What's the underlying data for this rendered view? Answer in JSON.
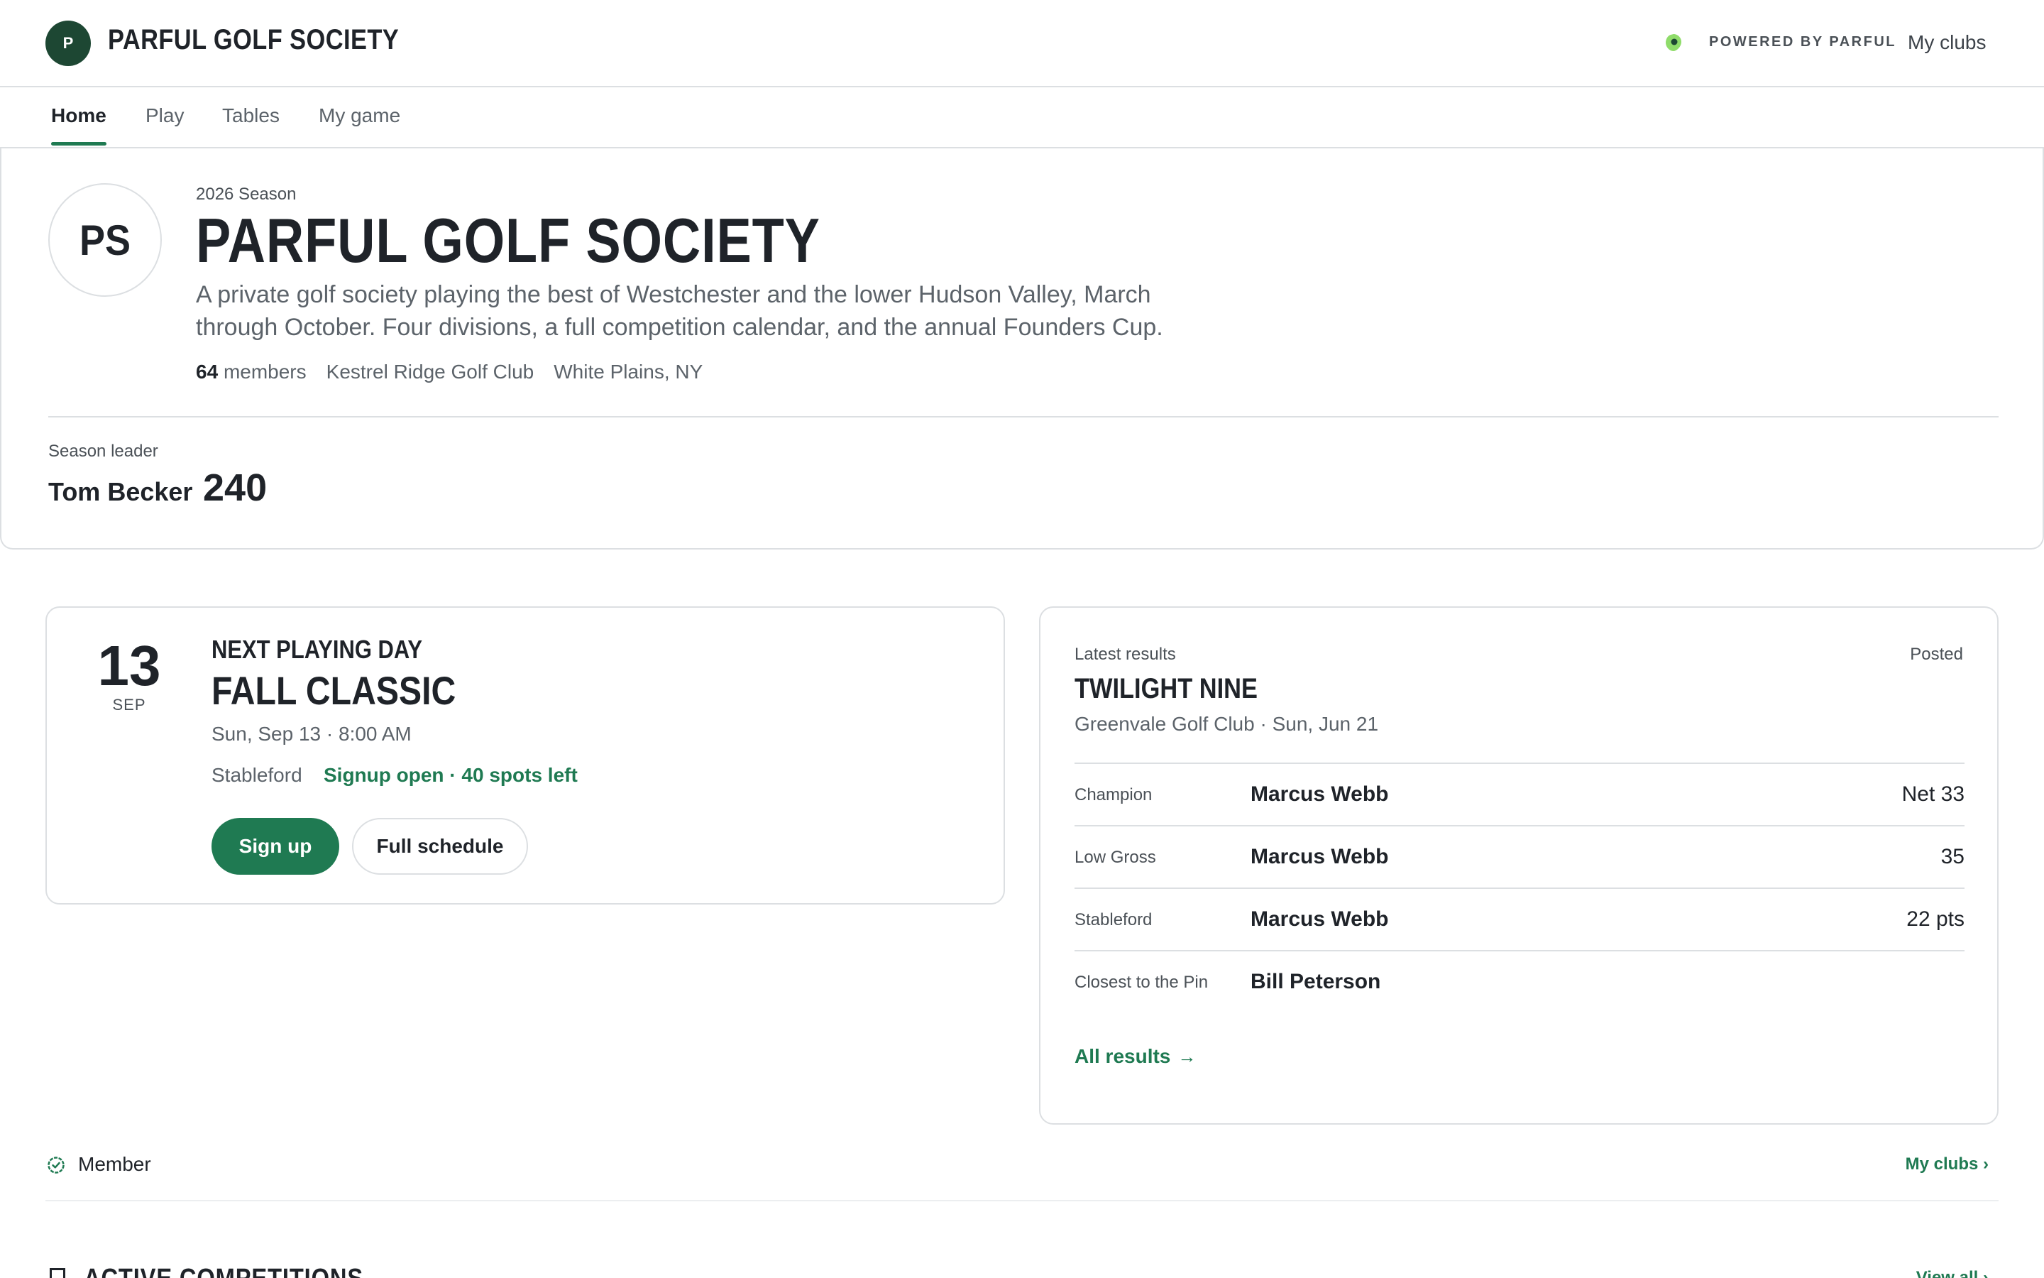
{
  "header": {
    "logo_letter": "P",
    "brand_name": "PARFUL GOLF SOCIETY",
    "powered_by": "POWERED BY PARFUL",
    "my_clubs": "My clubs"
  },
  "tabs": [
    {
      "label": "Home",
      "active": true
    },
    {
      "label": "Play",
      "active": false
    },
    {
      "label": "Tables",
      "active": false
    },
    {
      "label": "My game",
      "active": false
    }
  ],
  "hero": {
    "avatar_initials": "PS",
    "season": "2026 Season",
    "title": "PARFUL GOLF SOCIETY",
    "description": "A private golf society playing the best of Westchester and the lower Hudson Valley, March through October. Four divisions, a full competition calendar, and the annual Founders Cup.",
    "member_count": "64",
    "members_label": "members",
    "home_club": "Kestrel Ridge Golf Club",
    "location": "White Plains, NY",
    "leader_label": "Season leader",
    "leader_name": "Tom Becker",
    "leader_points": "240"
  },
  "next_day": {
    "day": "13",
    "month": "SEP",
    "kicker": "NEXT PLAYING DAY",
    "title": "FALL CLASSIC",
    "when": "Sun, Sep 13 · 8:00 AM",
    "format": "Stableford",
    "status": "Signup open · 40 spots left",
    "signup_label": "Sign up",
    "schedule_label": "Full schedule"
  },
  "results": {
    "label": "Latest results",
    "status": "Posted",
    "title": "TWILIGHT NINE",
    "subtitle": "Greenvale Golf Club · Sun, Jun 21",
    "rows": [
      {
        "category": "Champion",
        "name": "Marcus Webb",
        "score": "Net 33"
      },
      {
        "category": "Low Gross",
        "name": "Marcus Webb",
        "score": "35"
      },
      {
        "category": "Stableford",
        "name": "Marcus Webb",
        "score": "22 pts"
      },
      {
        "category": "Closest to the Pin",
        "name": "Bill Peterson",
        "score": ""
      }
    ],
    "all_results": "All results",
    "arrow": "→"
  },
  "membership": {
    "label": "Member",
    "link": "My clubs ›"
  },
  "active_section": {
    "heading": "ACTIVE COMPETITIONS",
    "link": "View all ›"
  },
  "colors": {
    "accent": "#1f7a52",
    "brand_dark": "#1d4733",
    "border": "#dcdfe2"
  }
}
